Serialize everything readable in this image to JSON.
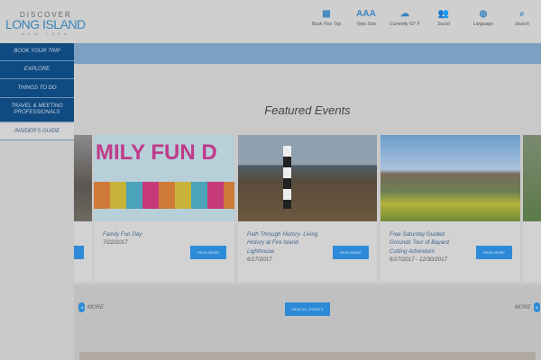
{
  "logo": {
    "line1": "DISCOVER",
    "line2": "LONG ISLAND",
    "line3": "NEW YORK"
  },
  "nav": [
    {
      "label": "Book Your Trip",
      "icon": "calendar-icon",
      "glyph": "▦"
    },
    {
      "label": "Type Size",
      "icon": "type-size-icon",
      "glyph": "AAA"
    },
    {
      "label": "Currently 52° F",
      "icon": "weather-cloud-icon",
      "glyph": "☁"
    },
    {
      "label": "Social",
      "icon": "social-people-icon",
      "glyph": "👥"
    },
    {
      "label": "Language",
      "icon": "globe-icon",
      "glyph": "◍"
    },
    {
      "label": "Search",
      "icon": "search-icon",
      "glyph": "⌕"
    }
  ],
  "sidebar": [
    "BOOK YOUR TRIP",
    "EXPLORE",
    "THINGS TO DO",
    "TRAVEL & MEETING PROFESSIONALS",
    "INSIDER'S GUIDE"
  ],
  "section_title": "Featured Events",
  "events": [
    {
      "title": "Family Fun Day",
      "date": "7/22/2017",
      "button": "READ MORE",
      "image_text": "MILY FUN D"
    },
    {
      "title": "Path Through History- Living History at Fire Island Lighthouse",
      "date": "6/17/2017",
      "button": "READ MORE"
    },
    {
      "title": "Free Saturday Guided Grounds Tour of Bayard Cutting Arboretum",
      "date": "6/17/2017 - 12/30/2017",
      "button": "READ MORE"
    }
  ],
  "more_left": "MORE",
  "more_right": "MORE",
  "view_all": "VIEW ALL EVENTS"
}
